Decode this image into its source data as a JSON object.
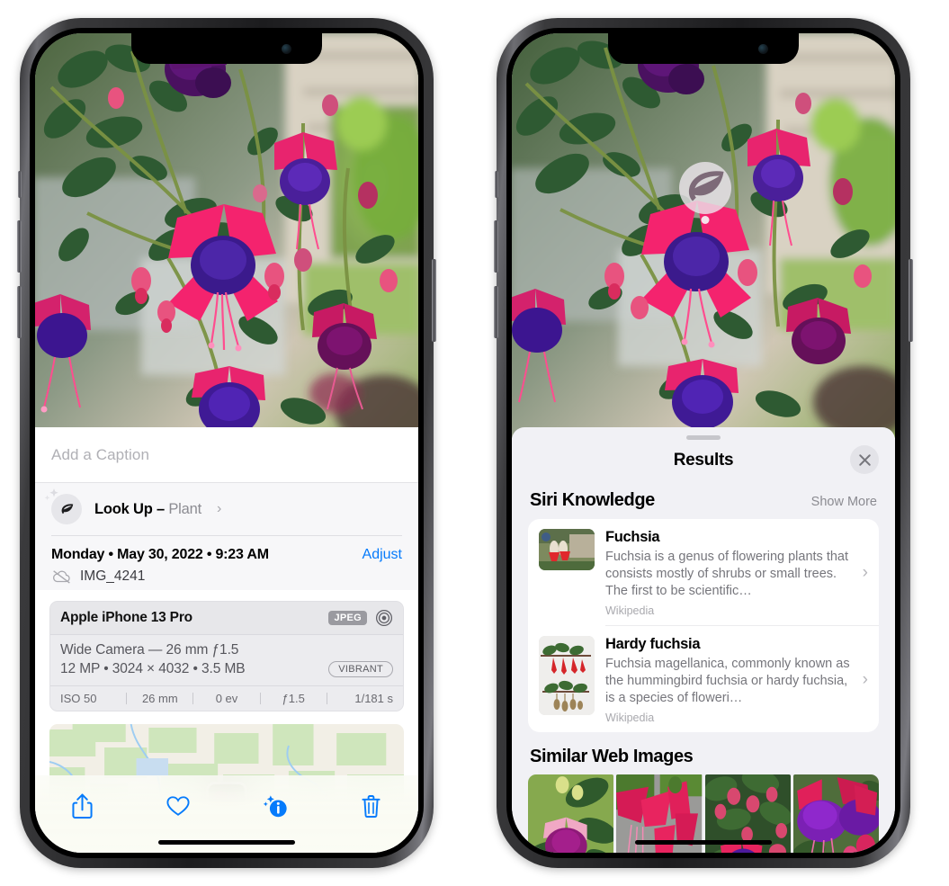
{
  "left_phone": {
    "caption": {
      "placeholder": "Add a Caption",
      "value": ""
    },
    "lookup": {
      "label": "Look Up – ",
      "subject": "Plant",
      "chevron": "›",
      "icon": "leaf-icon"
    },
    "meta": {
      "date": "Monday • May 30, 2022 • 9:23 AM",
      "adjust_label": "Adjust",
      "filename": "IMG_4241",
      "cloud_icon": "icloud-slash-icon"
    },
    "camera_card": {
      "device": "Apple iPhone 13 Pro",
      "format_badge": "JPEG",
      "lens_line": "Wide Camera — 26 mm ƒ1.5",
      "specs_line": "12 MP • 3024 × 4032 • 3.5 MB",
      "style_badge": "VIBRANT",
      "exif": [
        "ISO 50",
        "26 mm",
        "0 ev",
        "ƒ1.5",
        "1/181 s"
      ]
    },
    "toolbar": [
      {
        "name": "share-button",
        "icon": "share-icon"
      },
      {
        "name": "favorite-button",
        "icon": "heart-icon"
      },
      {
        "name": "info-button",
        "icon": "info-sparkle-icon"
      },
      {
        "name": "delete-button",
        "icon": "trash-icon"
      }
    ]
  },
  "right_phone": {
    "visual_lookup_badge": {
      "icon": "leaf-icon"
    },
    "sheet": {
      "title": "Results",
      "close_icon": "close-icon"
    },
    "siri_knowledge": {
      "section_title": "Siri Knowledge",
      "action": "Show More",
      "items": [
        {
          "title": "Fuchsia",
          "description": "Fuchsia is a genus of flowering plants that consists mostly of shrubs or small trees. The first to be scientific…",
          "source": "Wikipedia",
          "chevron": "›"
        },
        {
          "title": "Hardy fuchsia",
          "description": "Fuchsia magellanica, commonly known as the hummingbird fuchsia or hardy fuchsia, is a species of floweri…",
          "source": "Wikipedia",
          "chevron": "›"
        }
      ]
    },
    "similar_web_images": {
      "section_title": "Similar Web Images",
      "tiles": [
        "web-image-1",
        "web-image-2",
        "web-image-3",
        "web-image-4"
      ]
    }
  },
  "colors": {
    "accent_blue": "#067bfb",
    "sheet_bg": "#f1f1f5",
    "card_bg": "#ffffff",
    "muted_text": "#8b8b91"
  }
}
